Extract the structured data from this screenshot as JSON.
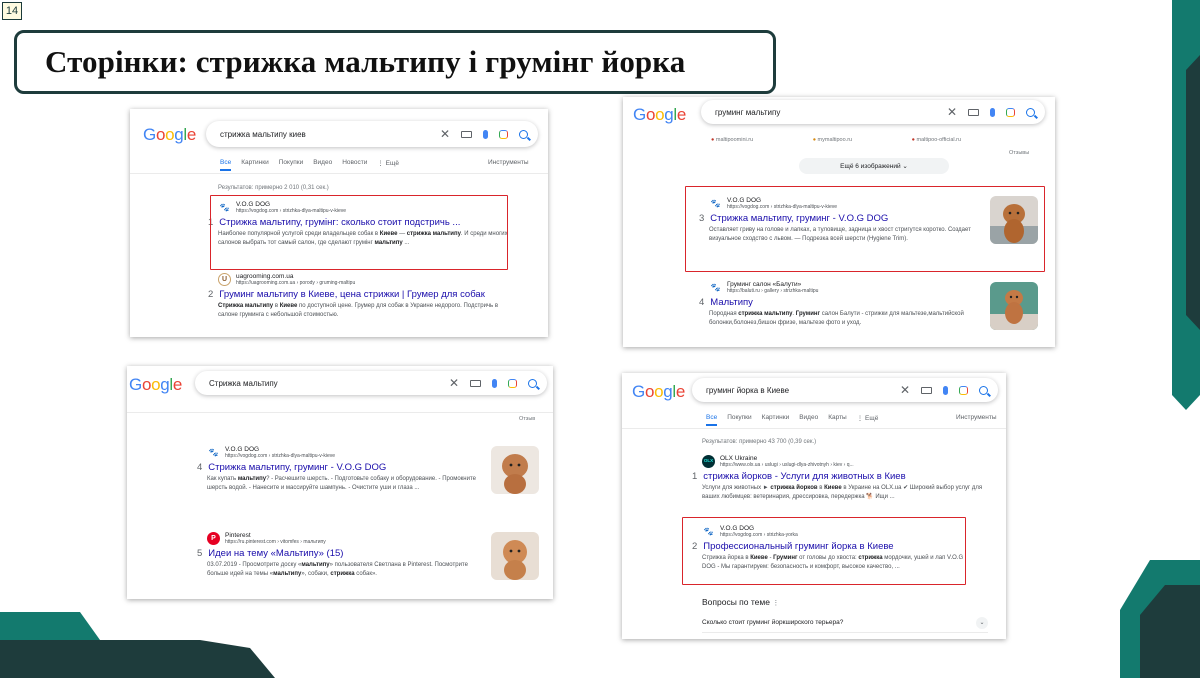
{
  "slide": {
    "number": "14",
    "title": "Сторінки: стрижка мальтипу і грумінг йорка"
  },
  "colors": {
    "accent_teal": "#137a6e",
    "dark_teal": "#1e3c3c",
    "highlight_red": "#d9252b",
    "link_blue": "#1a0dab"
  },
  "google_logo": [
    "G",
    "o",
    "o",
    "g",
    "l",
    "e"
  ],
  "shots": [
    {
      "query": "стрижка мальтипу киев",
      "tabs": [
        "Все",
        "Картинки",
        "Покупки",
        "Видео",
        "Новости",
        "⋮ Ещё"
      ],
      "tools": "Инструменты",
      "stats": "Результатов: примерно 2 010 (0,31 сек.)",
      "results": [
        {
          "name": "V.O.G DOG",
          "url": "https://vogdog.com › strizhka-dlya-maltipu-v-kieve",
          "num": "1",
          "title": "Стрижка мальтипу, грумінг: сколько стоит подстричь ...",
          "snippet": "Наиболее популярной услугой среди владельцев собак в Киеве — стрижка мальтипу. И среди многих салонов выбрать тот самый салон, где сделают грумінг мальтипу ...",
          "icon": "paw-icon"
        },
        {
          "name": "uagrooming.com.ua",
          "url": "https://uagrooming.com.ua › porody › gruming-maltipu",
          "num": "2",
          "title": "Груминг мальтипу в Киеве, цена стрижки | Грумер для собак",
          "snippet": "Стрижка мальтипу в Киеве по доступной цене. Грумер для собак в Украине недорого. Подстричь в салоне груминга с небольшой стоимостью.",
          "icon": "ua-logo-icon"
        }
      ]
    },
    {
      "query": "груминг мальтипу",
      "top_sites": [
        "maltipoomini.ru",
        "mymaltipoo.ru",
        "maltipoo-official.ru"
      ],
      "feedback": "Отзывы",
      "more_images": "Ещё 6 изображений",
      "results": [
        {
          "name": "V.O.G DOG",
          "url": "https://vogdog.com › strizhka-dlya-maltipu-v-kieve",
          "num": "3",
          "title": "Стрижка мальтипу, груминг - V.O.G DOG",
          "snippet": "Оставляет гриву на голове и лапках, а туловище, задница и хвост стригутся коротко. Создает визуальное сходство с львом. — Подрезка всей шерсти (Hygiene Trim).",
          "icon": "paw-icon"
        },
        {
          "name": "Груминг салон «Балути»",
          "url": "https://baluti.ru › gallery › strizhka-maltipu",
          "num": "4",
          "title": "Мальтипу",
          "snippet": "Породная стрижка мальтипу. Груминг салон Балути - стрижки для мальтезе,мальтийской болонки,болонез,бишон фризе, мальтезе фото и уход.",
          "icon": "paw-icon"
        }
      ]
    },
    {
      "query": "Стрижка мальтипу",
      "feedback": "Отзыв",
      "results": [
        {
          "name": "V.O.G DOG",
          "url": "https://vogdog.com › strizhka-dlya-maltipu-v-kieve",
          "num": "4",
          "title": "Стрижка мальтипу, груминг - V.O.G DOG",
          "snippet": "Как купать мальтипу? - Расчешите шерсть. - Подготовьте собаку и оборудование. - Промокните шерсть водой. - Нанесите и массируйте шампунь. - Очистите уши и глаза ...",
          "icon": "paw-icon"
        },
        {
          "name": "Pinterest",
          "url": "https://ru.pinterest.com › vitomfes › maльтипу",
          "num": "5",
          "title": "Идеи на тему «Мальтипу» (15)",
          "snippet": "03.07.2019 - Просмотрите доску «мальтипу» пользователя Светлана в Pinterest. Посмотрите больше идей на темы «мальтипу», собаки, стрижка собак».",
          "icon": "pinterest-icon"
        }
      ]
    },
    {
      "query": "груминг йорка в Киеве",
      "tabs": [
        "Все",
        "Покупки",
        "Картинки",
        "Видео",
        "Карты",
        "⋮ Ещё"
      ],
      "tools": "Инструменты",
      "stats": "Результатов: примерно 43 700 (0,39 сек.)",
      "results": [
        {
          "name": "OLX Ukraine",
          "url": "https://www.olx.ua › uslugi › uslugi-dlya-zhivotnyh › kiev › q...",
          "num": "1",
          "title": "стрижка йорков - Услуги для животных в Киев",
          "snippet": "Услуги для животных ► стрижка йорков в Киеве в Украине на OLX.ua ✔ Широкий выбор услуг для ваших любимцев: ветеринария, дрессировка, передержка 🐕 Ищи ...",
          "icon": "olx-icon"
        },
        {
          "name": "V.O.G DOG",
          "url": "https://vogdog.com › strizhka-yorka",
          "num": "2",
          "title": "Профессиональный груминг йорка в Киеве",
          "snippet": "Стрижка йорка в Киеве - Груминг от головы до хвоста: стрижка мордочки, ушей и лап V.O.G DOG - Мы гарантируем: безопасность и комфорт, высокое качество, ...",
          "icon": "paw-icon"
        }
      ],
      "questions_heading": "Вопросы по теме",
      "question": "Сколько стоит груминг йоркширского терьера?"
    }
  ]
}
